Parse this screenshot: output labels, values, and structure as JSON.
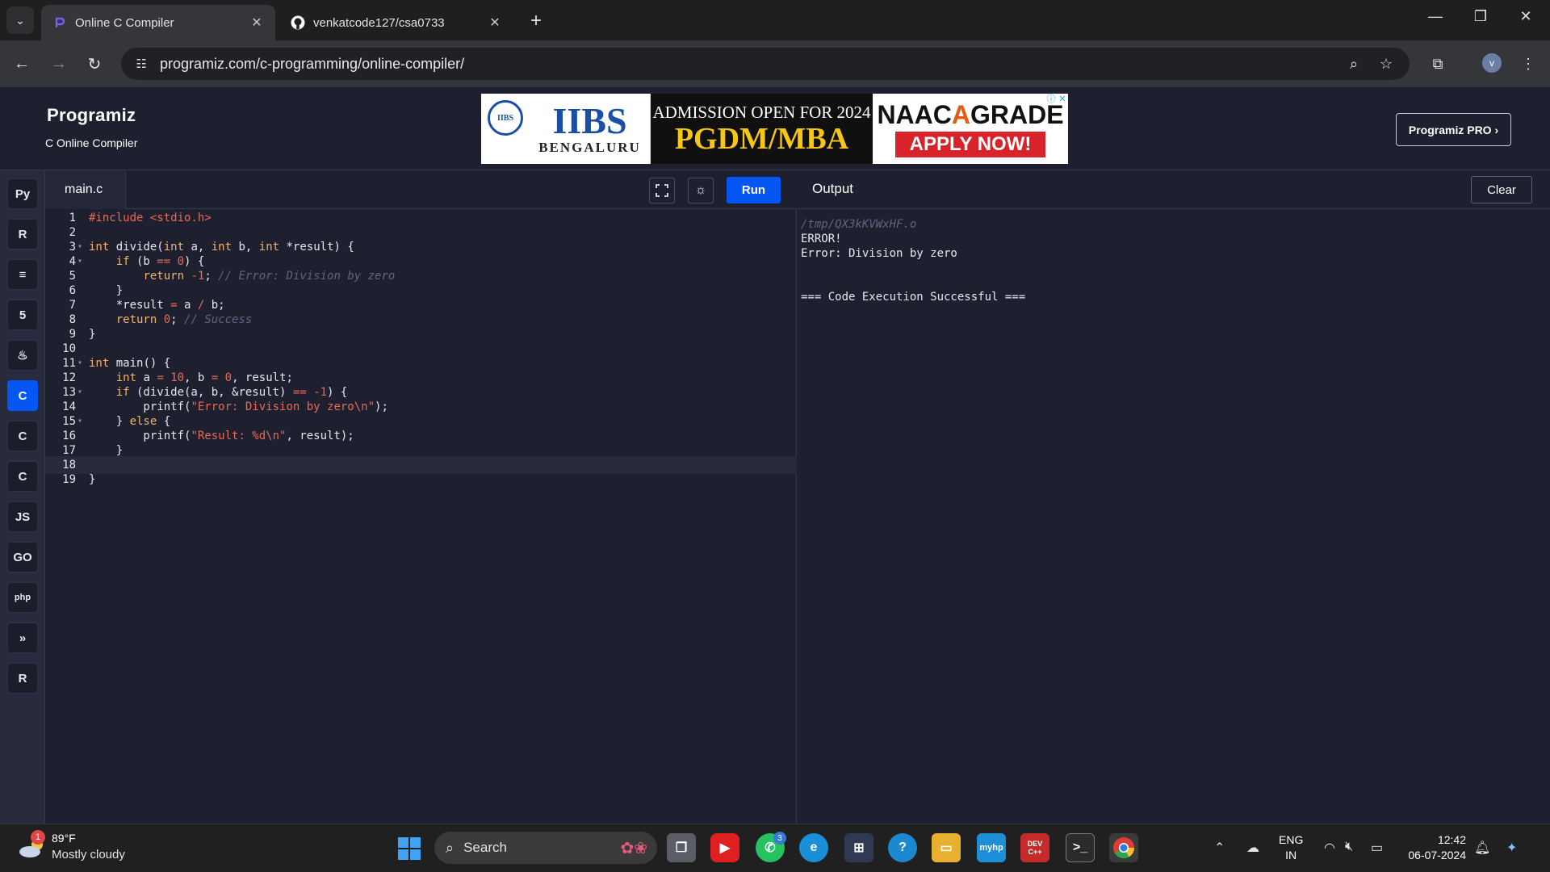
{
  "browser": {
    "tabs": [
      {
        "title": "Online C Compiler",
        "active": true,
        "favicon": "programiz-icon"
      },
      {
        "title": "venkatcode127/csa0733",
        "active": false,
        "favicon": "github-icon"
      }
    ],
    "url": "programiz.com/c-programming/online-compiler/",
    "profile_initial": "v"
  },
  "site": {
    "logo": "Programiz",
    "subtitle": "C Online Compiler",
    "pro_button": "Programiz PRO ›",
    "ad": {
      "brand": "IIBS",
      "city": "BENGALURU",
      "headline": "ADMISSION OPEN FOR 2024",
      "program": "PGDM/MBA",
      "naac_prefix": "NAAC",
      "naac_grade": "A",
      "naac_suffix": "GRADE",
      "cta": "APPLY NOW!"
    }
  },
  "sidebar": {
    "languages": [
      {
        "name": "python",
        "glyph": "Py",
        "active": false
      },
      {
        "name": "r",
        "glyph": "R",
        "active": false
      },
      {
        "name": "sql",
        "glyph": "≡",
        "active": false
      },
      {
        "name": "html",
        "glyph": "5",
        "active": false
      },
      {
        "name": "java",
        "glyph": "♨",
        "active": false
      },
      {
        "name": "c",
        "glyph": "C",
        "active": true
      },
      {
        "name": "cpp",
        "glyph": "C",
        "active": false
      },
      {
        "name": "csharp",
        "glyph": "C",
        "active": false
      },
      {
        "name": "javascript",
        "glyph": "JS",
        "active": false
      },
      {
        "name": "go",
        "glyph": "GO",
        "active": false
      },
      {
        "name": "php",
        "glyph": "php",
        "active": false
      },
      {
        "name": "swift",
        "glyph": "»",
        "active": false
      },
      {
        "name": "rust",
        "glyph": "R",
        "active": false
      }
    ]
  },
  "editor": {
    "filename": "main.c",
    "run_label": "Run",
    "current_line": 18,
    "lines": [
      "#include <stdio.h>",
      "",
      "int divide(int a, int b, int *result) {",
      "    if (b == 0) {",
      "        return -1; // Error: Division by zero",
      "    }",
      "    *result = a / b;",
      "    return 0; // Success",
      "}",
      "",
      "int main() {",
      "    int a = 10, b = 0, result;",
      "    if (divide(a, b, &result) == -1) {",
      "        printf(\"Error: Division by zero\\n\");",
      "    } else {",
      "        printf(\"Result: %d\\n\", result);",
      "    }",
      "",
      "}"
    ],
    "foldable_lines": [
      3,
      4,
      11,
      13,
      15
    ]
  },
  "output": {
    "title": "Output",
    "clear_label": "Clear",
    "lines": [
      {
        "text": "/tmp/QX3kKVWxHF.o",
        "kind": "path"
      },
      {
        "text": "ERROR!",
        "kind": "normal"
      },
      {
        "text": "Error: Division by zero",
        "kind": "normal"
      },
      {
        "text": "",
        "kind": "normal"
      },
      {
        "text": "",
        "kind": "normal"
      },
      {
        "text": "=== Code Execution Successful ===",
        "kind": "normal"
      }
    ]
  },
  "taskbar": {
    "weather": {
      "badge": "1",
      "temp": "89°F",
      "condition": "Mostly cloudy"
    },
    "search_label": "Search",
    "whatsapp_badge": "3",
    "devcpp_label": "DEV C++",
    "language": {
      "line1": "ENG",
      "line2": "IN"
    },
    "time": "12:42",
    "date": "06-07-2024"
  },
  "colors": {
    "accent": "#0556f3",
    "editor_bg": "#1e2030",
    "keyword": "#f2b36b",
    "literal": "#e86a55",
    "comment": "#5e667e"
  }
}
